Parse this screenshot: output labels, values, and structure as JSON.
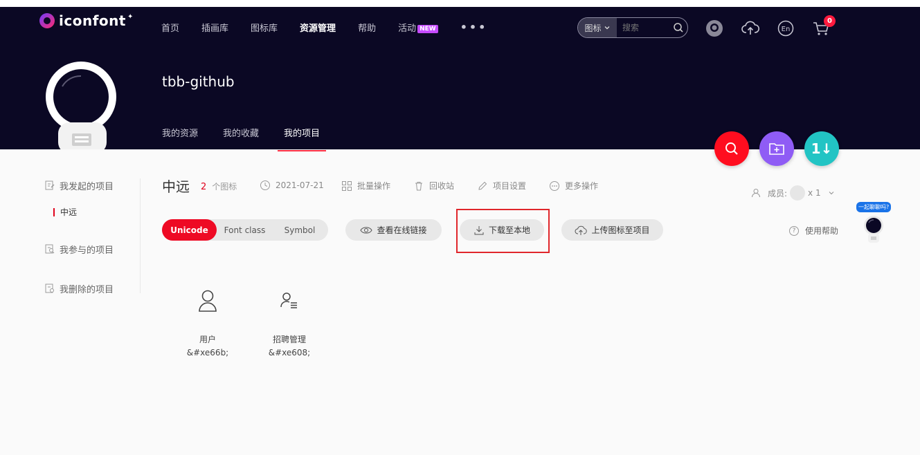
{
  "header": {
    "logo_text": "iconfont",
    "nav": [
      "首页",
      "插画库",
      "图标库",
      "资源管理",
      "帮助",
      "活动"
    ],
    "nav_active": "资源管理",
    "new_badge": "NEW",
    "more": "•••",
    "search_type": "图标",
    "search_placeholder": "搜索",
    "cart_count": "0"
  },
  "profile": {
    "username": "tbb-github",
    "tabs": [
      "我的资源",
      "我的收藏",
      "我的项目"
    ],
    "active_tab": "我的项目"
  },
  "fab": {
    "colors": [
      "#ff0d1f",
      "#8f5cf5",
      "#22c4c4"
    ],
    "third_label": "1↓"
  },
  "sidebar": {
    "items": [
      "我发起的项目",
      "我参与的项目",
      "我删除的项目"
    ],
    "sub_item": "中远"
  },
  "project": {
    "name": "中远",
    "count": "2",
    "count_unit": "个图标",
    "date": "2021-07-21",
    "batch": "批量操作",
    "recycle": "回收站",
    "settings": "项目设置",
    "more": "更多操作",
    "members_label": "成员:",
    "members_count": "x 1"
  },
  "actions": {
    "segments": [
      "Unicode",
      "Font class",
      "Symbol"
    ],
    "active_segment": "Unicode",
    "view_online": "查看在线链接",
    "download": "下载至本地",
    "upload": "上传图标至项目",
    "help": "使用帮助",
    "chat_bubble": "一起聊聊吗?"
  },
  "icons": [
    {
      "name": "用户",
      "code": "&#xe66b;",
      "icon": "user-icon"
    },
    {
      "name": "招聘管理",
      "code": "&#xe608;",
      "icon": "recruit-icon"
    }
  ],
  "colors": {
    "hero_bg": "#0b0824",
    "accent": "#ee0a24"
  }
}
